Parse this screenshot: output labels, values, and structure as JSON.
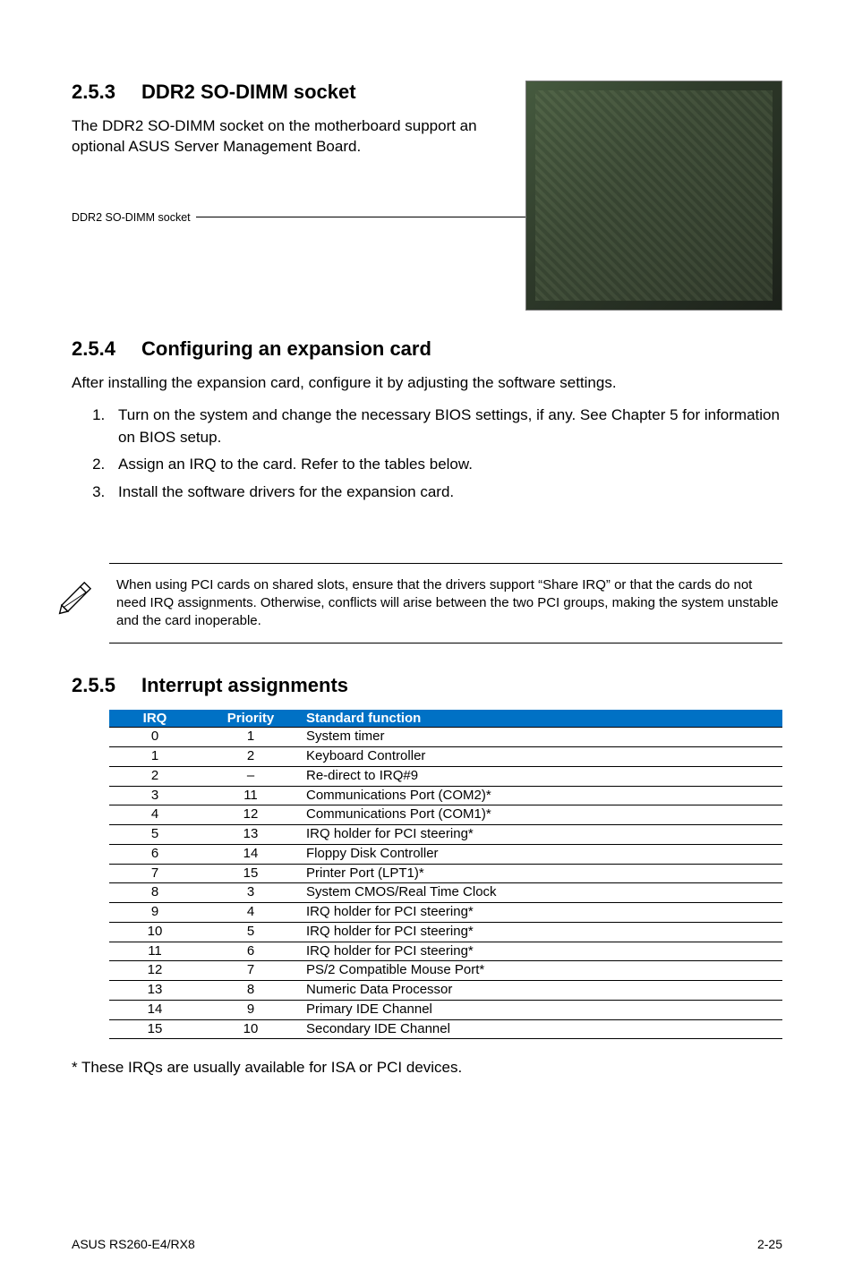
{
  "section_253": {
    "num": "2.5.3",
    "title": "DDR2 SO-DIMM socket",
    "body": "The DDR2 SO-DIMM socket on the motherboard support an optional ASUS Server Management Board.",
    "caption": "DDR2 SO-DIMM socket"
  },
  "section_254": {
    "num": "2.5.4",
    "title": "Configuring an expansion card",
    "body": "After installing the expansion card, configure it by adjusting the software settings.",
    "steps": [
      "Turn on the system and change the necessary BIOS settings, if any. See Chapter 5 for information on BIOS setup.",
      "Assign an IRQ to the card. Refer to the tables below.",
      "Install the software drivers for the expansion card."
    ],
    "note": "When using PCI cards on shared slots, ensure that the drivers support “Share IRQ” or that the cards do not need IRQ assignments. Otherwise, conflicts will arise between the two PCI groups, making the system unstable and the card inoperable."
  },
  "section_255": {
    "num": "2.5.5",
    "title": "Interrupt assignments",
    "headers": [
      "IRQ",
      "Priority",
      "Standard function"
    ],
    "rows": [
      [
        "0",
        "1",
        "System timer"
      ],
      [
        "1",
        "2",
        "Keyboard Controller"
      ],
      [
        "2",
        "–",
        "Re-direct to IRQ#9"
      ],
      [
        "3",
        "11",
        "Communications Port (COM2)*"
      ],
      [
        "4",
        "12",
        "Communications Port (COM1)*"
      ],
      [
        "5",
        "13",
        "IRQ holder for PCI steering*"
      ],
      [
        "6",
        "14",
        "Floppy Disk Controller"
      ],
      [
        "7",
        "15",
        "Printer Port (LPT1)*"
      ],
      [
        "8",
        "3",
        "System CMOS/Real Time Clock"
      ],
      [
        "9",
        "4",
        "IRQ holder for PCI steering*"
      ],
      [
        "10",
        "5",
        "IRQ holder for PCI steering*"
      ],
      [
        "11",
        "6",
        "IRQ holder for PCI steering*"
      ],
      [
        "12",
        "7",
        "PS/2 Compatible Mouse Port*"
      ],
      [
        "13",
        "8",
        "Numeric Data Processor"
      ],
      [
        "14",
        "9",
        "Primary IDE Channel"
      ],
      [
        "15",
        "10",
        "Secondary IDE Channel"
      ]
    ],
    "footnote": "* These IRQs are usually available for ISA or PCI devices."
  },
  "footer": {
    "left": "ASUS RS260-E4/RX8",
    "right": "2-25"
  }
}
